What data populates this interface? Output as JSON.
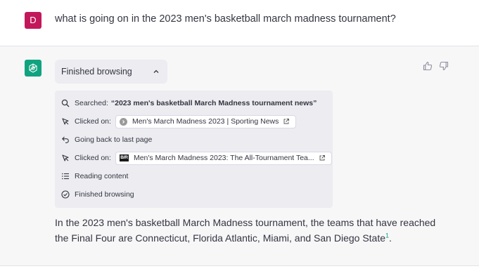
{
  "user_message": {
    "avatar_letter": "D",
    "avatar_color": "#c2185b",
    "text": "what is going on in the 2023 men's basketball march madness tournament?"
  },
  "assistant": {
    "avatar_icon": "openai-logo-icon",
    "avatar_color": "#10a37f",
    "browsing_header": "Finished browsing",
    "steps": [
      {
        "icon": "search-icon",
        "label": "Searched:",
        "query": "“2023 men's basketball March Madness tournament news”"
      },
      {
        "icon": "cursor-click-icon",
        "label": "Clicked on:",
        "link_text": "Men's March Madness 2023 | Sporting News",
        "favicon": "sporting-news-favicon"
      },
      {
        "icon": "back-arrow-icon",
        "label": "Going back to last page"
      },
      {
        "icon": "cursor-click-icon",
        "label": "Clicked on:",
        "link_text": "Men's March Madness 2023: The All-Tournament Tea...",
        "favicon": "bleacher-report-favicon",
        "favicon_text": "B/R"
      },
      {
        "icon": "list-icon",
        "label": "Reading content"
      },
      {
        "icon": "check-circle-icon",
        "label": "Finished browsing"
      }
    ],
    "answer_text": "In the 2023 men's basketball March Madness tournament, the teams that have reached the Final Four are Connecticut, Florida Atlantic, Miami, and San Diego State",
    "citation": "1",
    "answer_end": ".",
    "citation_color": "#10a37f"
  }
}
